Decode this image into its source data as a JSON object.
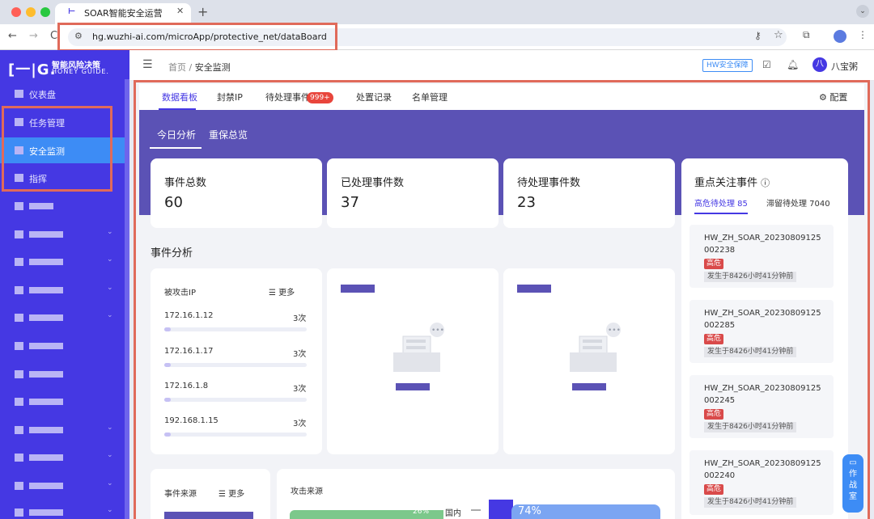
{
  "browser": {
    "tab_title": "SOAR智能安全运营",
    "url": "hg.wuzhi-ai.com/microApp/protective_net/dataBoard"
  },
  "logo": {
    "mark": "[一|G.",
    "cn": "智能风险决策",
    "en": "HONEY GUIDE."
  },
  "sidebar": {
    "items": [
      {
        "label": "仪表盘"
      },
      {
        "label": "任务管理"
      },
      {
        "label": "安全监测"
      },
      {
        "label": "指挥"
      }
    ]
  },
  "header": {
    "breadcrumb_home": "首页",
    "breadcrumb_sep": "/",
    "breadcrumb_current": "安全监测",
    "hw_badge": "HW安全保障",
    "avatar": "八",
    "user": "八宝粥"
  },
  "tabs": {
    "items": [
      "数据看板",
      "封禁IP",
      "待处理事件",
      "处置记录",
      "名单管理"
    ],
    "badge": "999+",
    "config": "配置"
  },
  "subtabs": [
    "今日分析",
    "重保总览"
  ],
  "stats": [
    {
      "label": "事件总数",
      "value": "60"
    },
    {
      "label": "已处理事件数",
      "value": "37"
    },
    {
      "label": "待处理事件数",
      "value": "23"
    }
  ],
  "analysis": {
    "title": "事件分析",
    "attacked_ip": {
      "title": "被攻击IP",
      "more": "更多",
      "rows": [
        {
          "ip": "172.16.1.12",
          "count": "3次"
        },
        {
          "ip": "172.16.1.17",
          "count": "3次"
        },
        {
          "ip": "172.16.1.8",
          "count": "3次"
        },
        {
          "ip": "192.168.1.15",
          "count": "3次"
        }
      ]
    },
    "event_source": {
      "title": "事件来源",
      "more": "更多"
    },
    "attack_source": {
      "title": "攻击来源",
      "pct_left": "26%",
      "domestic": "国内",
      "pct_right": "74%"
    }
  },
  "focus": {
    "title": "重点关注事件",
    "tab_high": "高危待处理 85",
    "tab_stale": "滞留待处理 7040",
    "level": "高危",
    "cards": [
      {
        "line1": "HW_ZH_SOAR_20230809125",
        "line2": "002238",
        "time": "发生于8426小时41分钟前"
      },
      {
        "line1": "HW_ZH_SOAR_20230809125",
        "line2": "002285",
        "time": "发生于8426小时41分钟前"
      },
      {
        "line1": "HW_ZH_SOAR_20230809125",
        "line2": "002245",
        "time": "发生于8426小时41分钟前"
      },
      {
        "line1": "HW_ZH_SOAR_20230809125",
        "line2": "002240",
        "time": "发生于8426小时41分钟前"
      }
    ]
  },
  "float_button": {
    "line1": "作",
    "line2": "战",
    "line3": "室"
  },
  "colors": {
    "sidebar": "#4538e3",
    "active": "#3d8cf5",
    "banner": "#5b52b5",
    "danger": "#d94a4a",
    "highlight_box": "#e06a5a"
  },
  "icons": [
    "browser-back-icon",
    "browser-forward-icon",
    "reload-icon",
    "site-settings-icon",
    "key-icon",
    "star-icon",
    "extensions-icon",
    "profile-icon",
    "menu-icon",
    "collapse-menu-icon",
    "checklist-icon",
    "bell-icon",
    "gear-icon",
    "info-icon",
    "list-icon",
    "monitor-icon",
    "mail-empty-icon"
  ]
}
